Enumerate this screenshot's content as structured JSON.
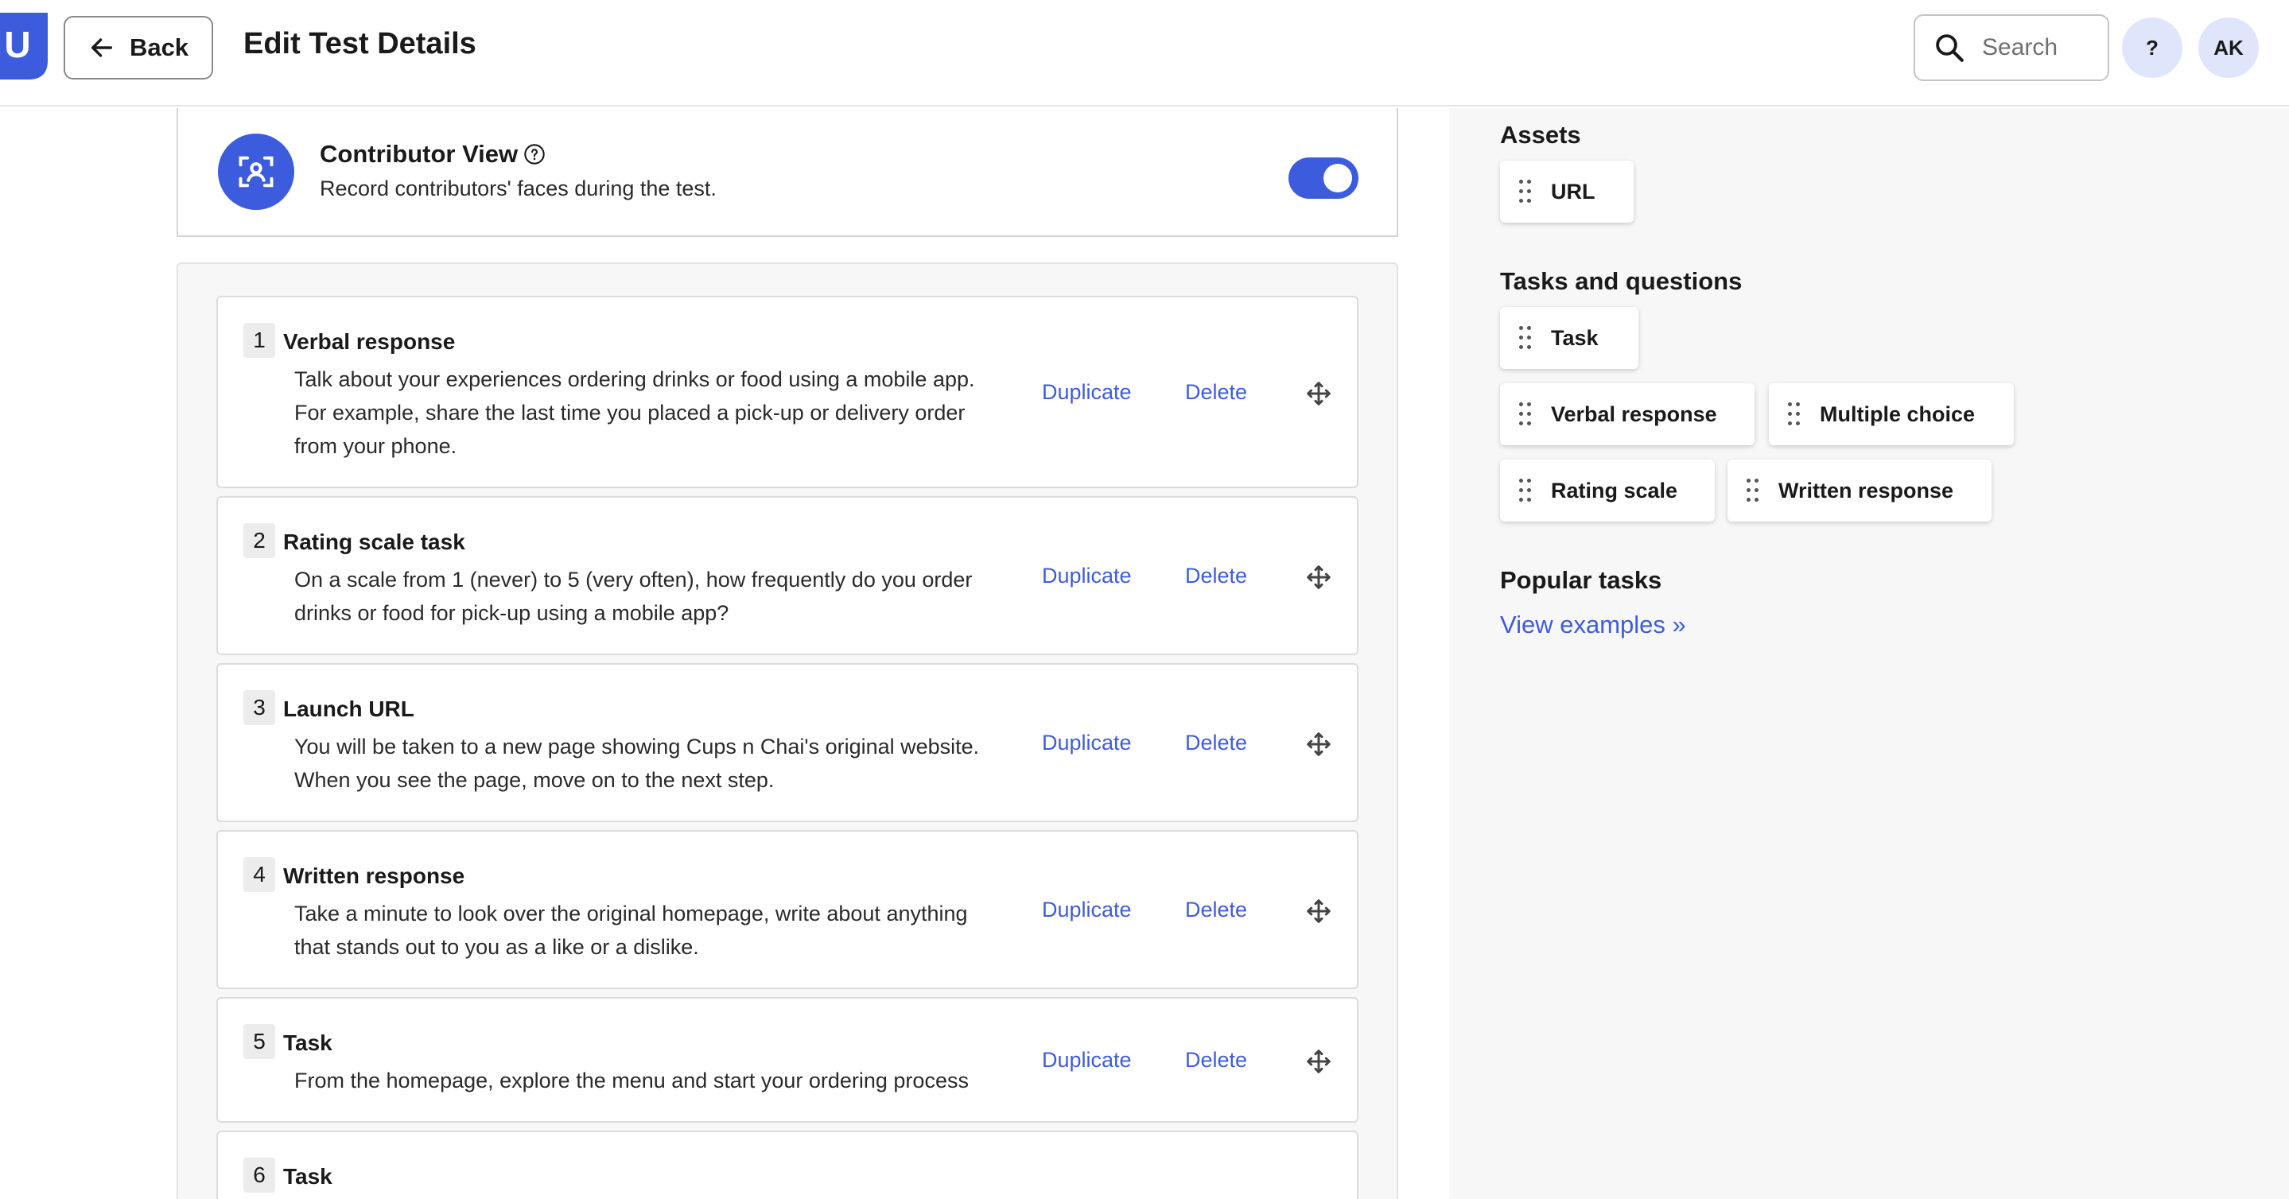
{
  "header": {
    "back_label": "Back",
    "title": "Edit Test Details",
    "search_placeholder": "Search",
    "help_label": "?",
    "avatar_initials": "AK",
    "logo_letter": "U"
  },
  "contributor_view": {
    "title": "Contributor View",
    "description": "Record contributors' faces during the test.",
    "enabled": true
  },
  "tasks": [
    {
      "number": "1",
      "title": "Verbal response",
      "body": "Talk about your experiences ordering drinks or food using a mobile app. For example, share the last time you placed a pick-up or delivery order from your phone.",
      "duplicate_label": "Duplicate",
      "delete_label": "Delete"
    },
    {
      "number": "2",
      "title": "Rating scale task",
      "body": "On a scale from 1 (never) to 5 (very often), how frequently do you order drinks or food for pick-up using a mobile app?",
      "duplicate_label": "Duplicate",
      "delete_label": "Delete"
    },
    {
      "number": "3",
      "title": "Launch URL",
      "body": "You will be taken to a new page showing Cups n Chai's original website. When you see the page, move on to the next step.",
      "duplicate_label": "Duplicate",
      "delete_label": "Delete"
    },
    {
      "number": "4",
      "title": "Written response",
      "body": "Take a minute to look over the original homepage, write about anything that stands out to you as a like or a dislike.",
      "duplicate_label": "Duplicate",
      "delete_label": "Delete"
    },
    {
      "number": "5",
      "title": "Task",
      "body": "From the homepage, explore the menu and start your ordering process",
      "duplicate_label": "Duplicate",
      "delete_label": "Delete"
    },
    {
      "number": "6",
      "title": "Task"
    }
  ],
  "sidebar": {
    "assets_title": "Assets",
    "assets": [
      "URL"
    ],
    "tasks_questions_title": "Tasks and questions",
    "tasks_questions": [
      "Task",
      "Verbal response",
      "Multiple choice",
      "Rating scale",
      "Written response"
    ],
    "popular_title": "Popular tasks",
    "view_examples_label": "View examples »"
  },
  "colors": {
    "accent": "#3d5cdd",
    "accent_light": "#dfe5fb",
    "panel_bg": "#f7f7f7"
  },
  "icons": {
    "back": "arrow-left-icon",
    "search": "search-icon",
    "contributor": "face-scan-icon",
    "help": "question-circle-icon",
    "move": "move-icon",
    "grip": "drag-handle-icon"
  }
}
